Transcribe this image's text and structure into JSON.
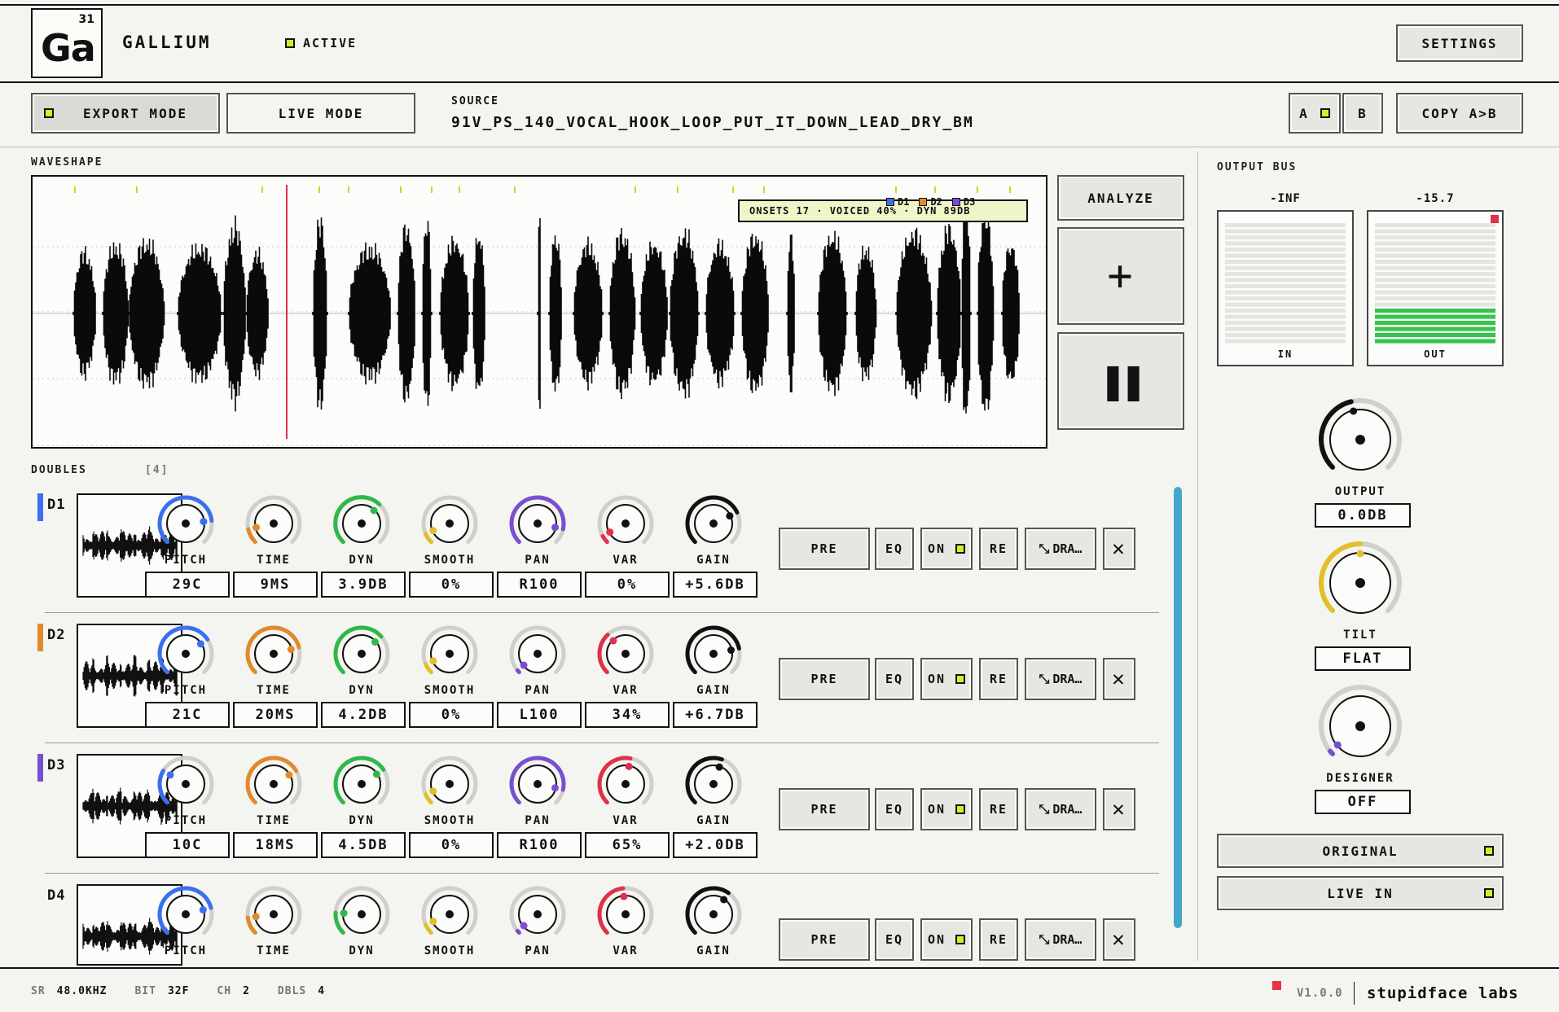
{
  "app": {
    "element_number": "31",
    "element_symbol": "Ga",
    "title": "GALLIUM",
    "status": "ACTIVE",
    "settings_label": "SETTINGS"
  },
  "toolbar": {
    "export_mode": "EXPORT MODE",
    "live_mode": "LIVE MODE",
    "source_label": "SOURCE",
    "source_name": "91V_PS_140_VOCAL_HOOK_LOOP_PUT_IT_DOWN_LEAD_DRY_BM",
    "a_label": "A",
    "b_label": "B",
    "copy_label": "COPY A>B"
  },
  "waveshape": {
    "label": "WAVESHAPE",
    "analysis": "ONSETS 17  ·  VOICED 40%  ·  DYN 89DB",
    "legend": [
      "D1",
      "D2",
      "D3"
    ],
    "analyze_label": "ANALYZE",
    "add_symbol": "+",
    "pause_symbol": "❚❚"
  },
  "doubles": {
    "label": "DOUBLES",
    "count": "[4]",
    "knob_labels": [
      "PITCH",
      "TIME",
      "DYN",
      "SMOOTH",
      "PAN",
      "VAR",
      "GAIN"
    ],
    "knob_colors": [
      "#3b6ff0",
      "#e08a2c",
      "#2fb84a",
      "#e2be2a",
      "#7a4ed0",
      "#e0304a",
      "#111111"
    ],
    "button_labels": {
      "pre": "PRE",
      "eq": "EQ",
      "on": "ON",
      "re": "RE",
      "drag": "DRA…",
      "remove": "✕"
    },
    "rows": [
      {
        "name": "D1",
        "color": "#3b6ff0",
        "values": [
          "29C",
          "9MS",
          "3.9DB",
          "0%",
          "R100",
          "0%",
          "+5.6DB"
        ],
        "levels": [
          0.81,
          0.12,
          0.66,
          0.08,
          0.88,
          0.06,
          0.74
        ]
      },
      {
        "name": "D2",
        "color": "#e08a2c",
        "values": [
          "21C",
          "20MS",
          "4.2DB",
          "0%",
          "L100",
          "34%",
          "+6.7DB"
        ],
        "levels": [
          0.71,
          0.78,
          0.68,
          0.08,
          0.02,
          0.34,
          0.79
        ]
      },
      {
        "name": "D3",
        "color": "#7a4ed0",
        "values": [
          "10C",
          "18MS",
          "4.5DB",
          "0%",
          "R100",
          "65%",
          "+2.0DB"
        ],
        "levels": [
          0.28,
          0.72,
          0.71,
          0.08,
          0.88,
          0.54,
          0.57
        ]
      },
      {
        "name": "D4",
        "color": "",
        "values": [
          "",
          "",
          "",
          "",
          "",
          "",
          ""
        ],
        "levels": [
          0.78,
          0.14,
          0.18,
          0.08,
          0.02,
          0.48,
          0.63
        ]
      }
    ]
  },
  "output_bus": {
    "label": "OUTPUT BUS",
    "in_value": "-INF",
    "out_value": "-15.7",
    "in_caption": "IN",
    "out_caption": "OUT",
    "out_level": 0.3,
    "output_label": "OUTPUT",
    "output_value": "0.0DB",
    "output_level": 0.45,
    "tilt_label": "TILT",
    "tilt_value": "FLAT",
    "tilt_level": 0.5,
    "designer_label": "DESIGNER",
    "designer_value": "OFF",
    "designer_level": 0.02,
    "original_label": "ORIGINAL",
    "live_in_label": "LIVE IN"
  },
  "footer": {
    "sr_key": "SR",
    "sr_val": "48.0KHZ",
    "bit_key": "BIT",
    "bit_val": "32F",
    "ch_key": "CH",
    "ch_val": "2",
    "dbls_key": "DBLS",
    "dbls_val": "4",
    "version": "V1.0.0",
    "brand": "stupidface labs"
  },
  "colors": {
    "accent_lime": "#d6ee2a",
    "playhead": "#e0304a",
    "scrollbar": "#44a6c8",
    "meter_green": "#36c44a"
  }
}
